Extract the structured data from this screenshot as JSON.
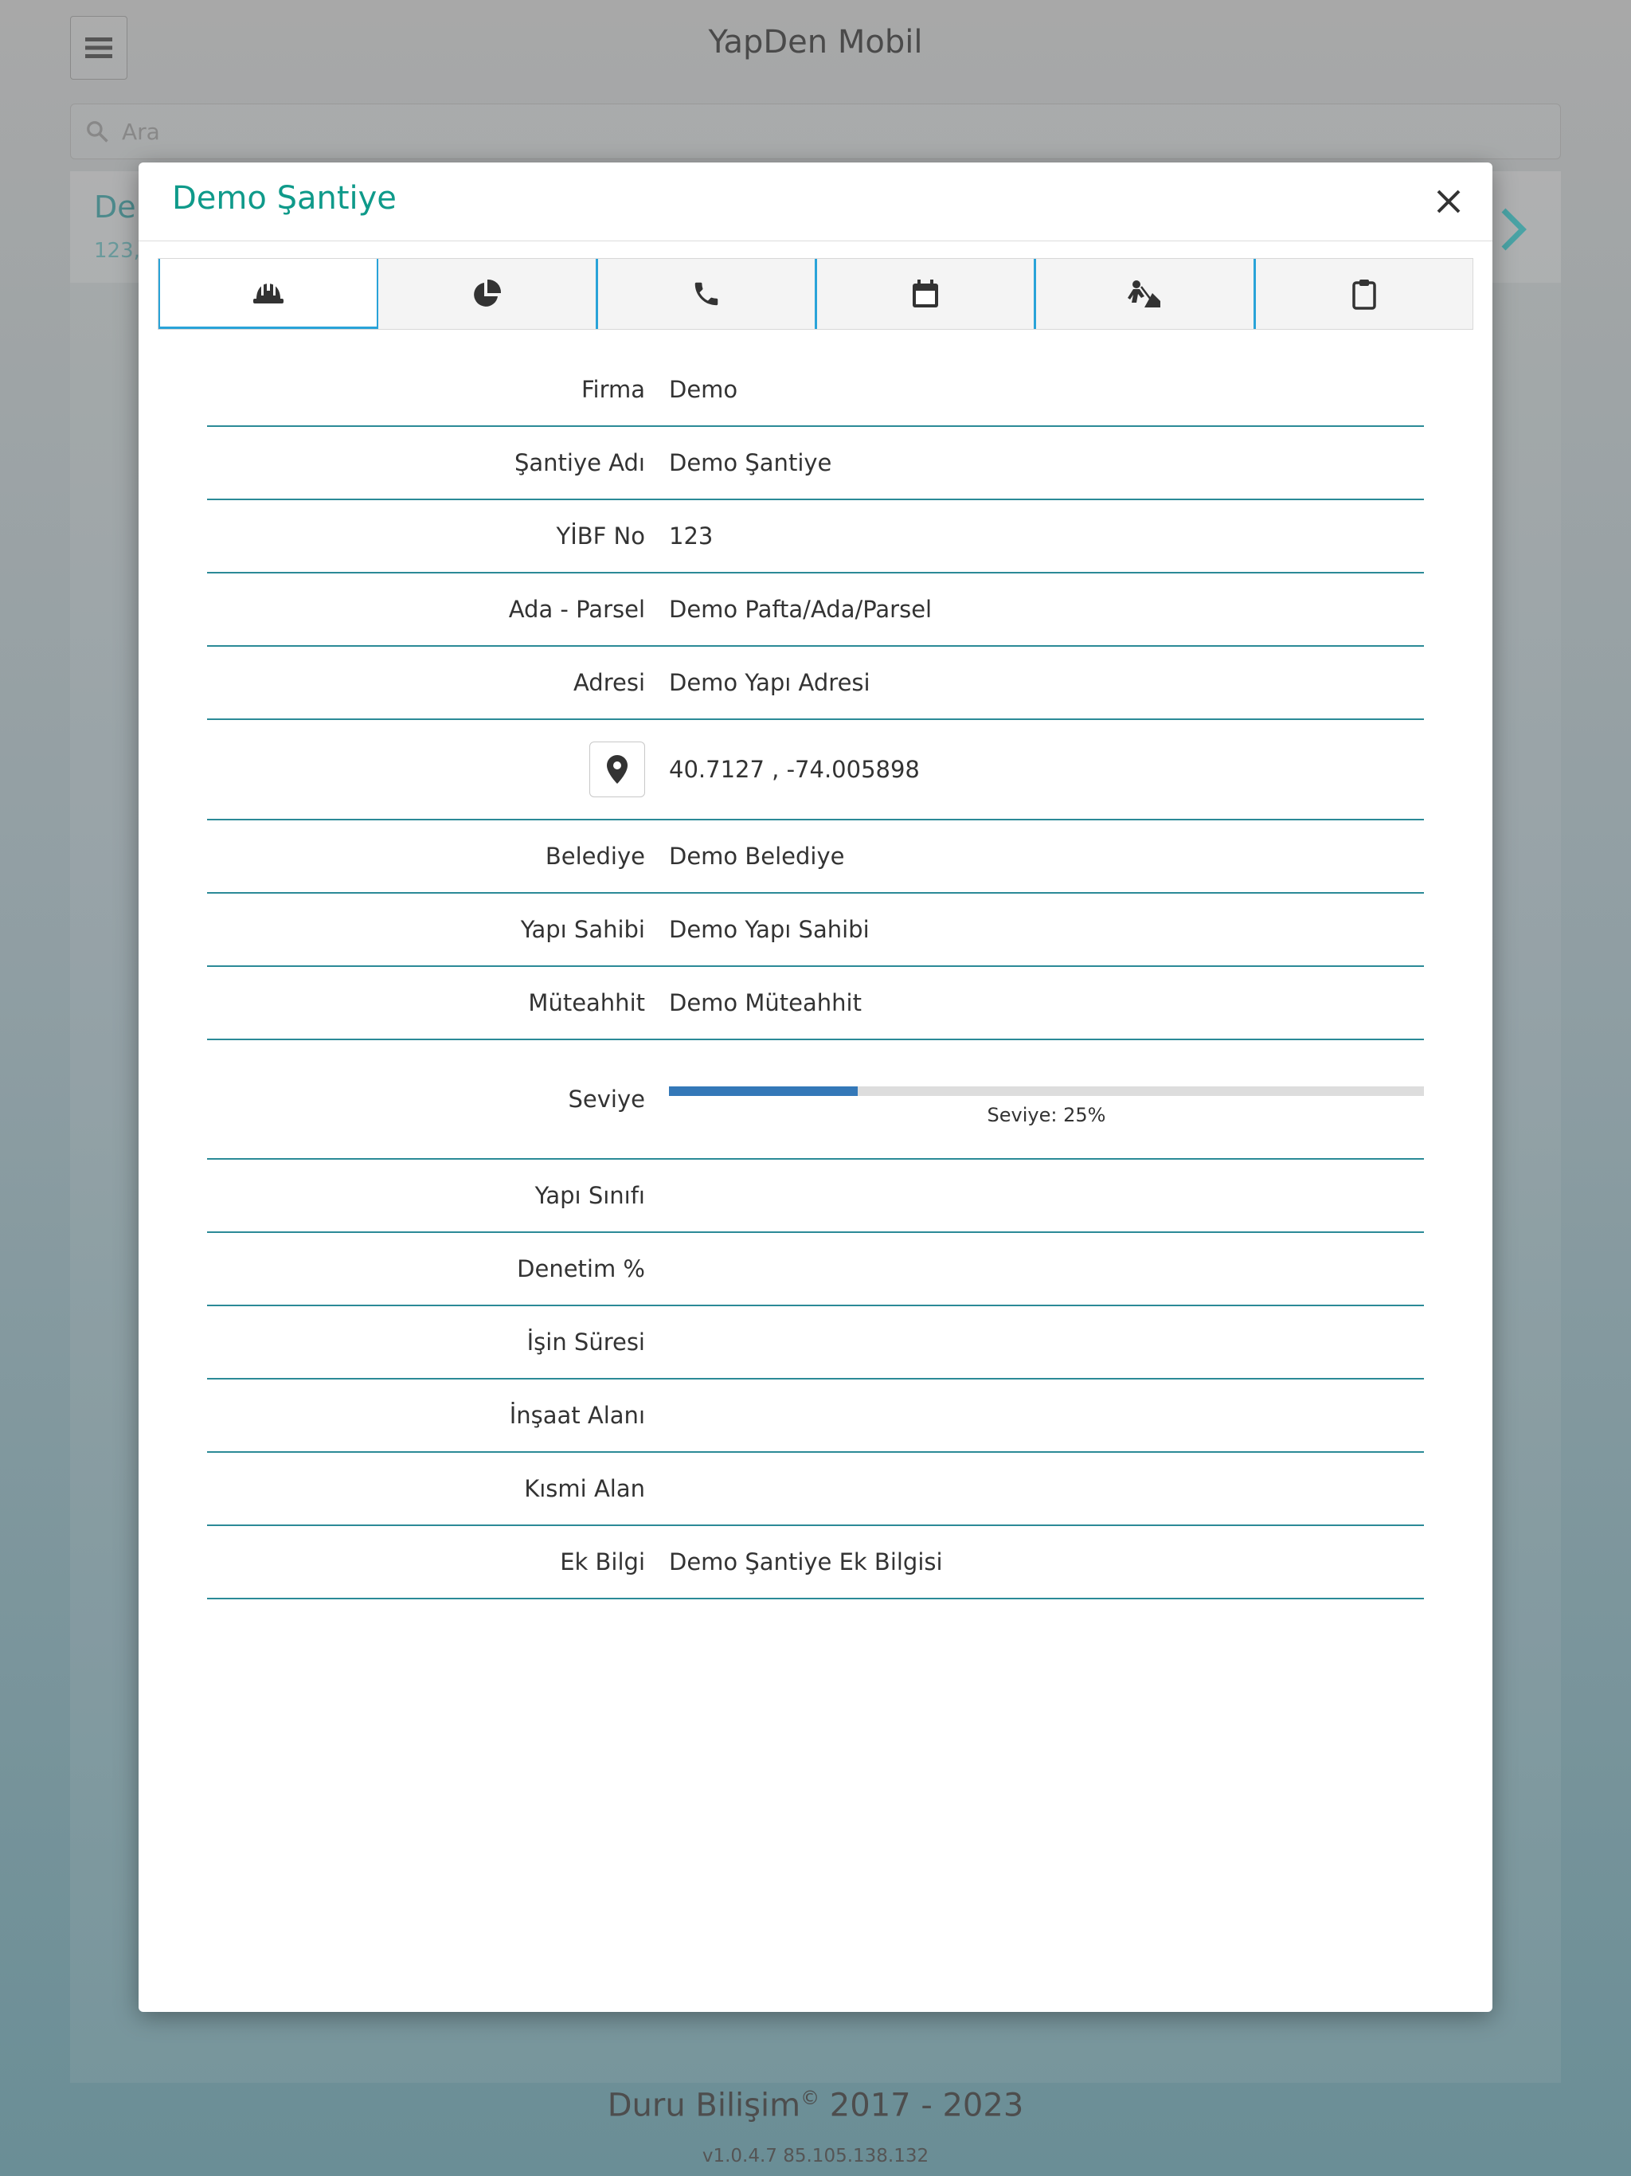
{
  "app": {
    "title": "YapDen Mobil",
    "search_placeholder": "Ara",
    "bg_card_title": "De",
    "bg_card_sub": "123,",
    "footer_title": "Duru Bilişim",
    "footer_copy": "©",
    "footer_years": " 2017 - 2023",
    "footer_version": "v1.0.4.7 85.105.138.132"
  },
  "modal": {
    "title": "Demo Şantiye",
    "tabs": [
      {
        "icon": "helmet-icon"
      },
      {
        "icon": "pie-chart-icon"
      },
      {
        "icon": "phone-icon"
      },
      {
        "icon": "calendar-icon"
      },
      {
        "icon": "worker-icon"
      },
      {
        "icon": "clipboard-icon"
      }
    ],
    "fields": {
      "firma": {
        "label": "Firma",
        "value": "Demo"
      },
      "santiye_adi": {
        "label": "Şantiye Adı",
        "value": "Demo Şantiye"
      },
      "yibf_no": {
        "label": "YİBF No",
        "value": "123"
      },
      "ada_parsel": {
        "label": "Ada - Parsel",
        "value": "Demo Pafta/Ada/Parsel"
      },
      "adresi": {
        "label": "Adresi",
        "value": "Demo Yapı Adresi"
      },
      "konum": {
        "value": "40.7127 , -74.005898"
      },
      "belediye": {
        "label": "Belediye",
        "value": "Demo Belediye"
      },
      "yapi_sahibi": {
        "label": "Yapı Sahibi",
        "value": "Demo Yapı Sahibi"
      },
      "muteahhit": {
        "label": "Müteahhit",
        "value": "Demo Müteahhit"
      },
      "seviye": {
        "label": "Seviye",
        "percent": 25,
        "text": "Seviye: 25%"
      },
      "yapi_sinifi": {
        "label": "Yapı Sınıfı",
        "value": ""
      },
      "denetim": {
        "label": "Denetim %",
        "value": ""
      },
      "isin_suresi": {
        "label": "İşin Süresi",
        "value": ""
      },
      "insaat_alani": {
        "label": "İnşaat Alanı",
        "value": ""
      },
      "kismi_alan": {
        "label": "Kısmi Alan",
        "value": ""
      },
      "ek_bilgi": {
        "label": "Ek Bilgi",
        "value": "Demo Şantiye Ek Bilgisi"
      }
    }
  },
  "colors": {
    "accent": "#0f9a8a",
    "row_line": "#2b8a97",
    "tab_border": "#29a3d8",
    "progress": "#3478b8"
  }
}
